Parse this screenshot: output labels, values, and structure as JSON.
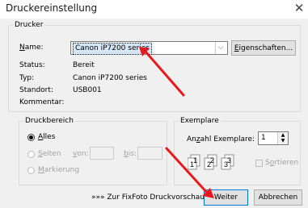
{
  "window": {
    "title": "Druckereinstellung",
    "close_glyph": "✕"
  },
  "printer": {
    "group_label": "Drucker",
    "name_label": "Name:",
    "name_value": "Canon iP7200 series",
    "properties_button": "Eigenschaften...",
    "status_label": "Status:",
    "status_value": "Bereit",
    "type_label": "Typ:",
    "type_value": "Canon iP7200 series",
    "location_label": "Standort:",
    "location_value": "USB001",
    "comment_label": "Kommentar:"
  },
  "print_range": {
    "group_label": "Druckbereich",
    "all_label": "Alles",
    "pages_label": "Seiten",
    "from_label": "von:",
    "to_label": "bis:",
    "selection_label": "Markierung",
    "selected": "all"
  },
  "copies": {
    "group_label": "Exemplare",
    "count_label": "Anzahl Exemplare:",
    "count_value": "1",
    "collate_label": "Sortieren"
  },
  "footer": {
    "preview_link": "»»» Zur FixFoto Druckvorschau »»»",
    "next_button": "Weiter",
    "cancel_button": "Abbrechen"
  },
  "annotations": {
    "arrow_color": "#e8191c"
  }
}
